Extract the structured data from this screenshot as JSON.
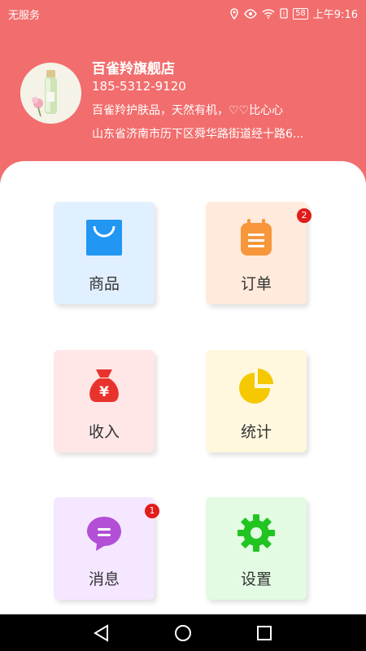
{
  "status_bar": {
    "carrier": "无服务",
    "battery": "58",
    "time": "上午9:16"
  },
  "profile": {
    "store_name": "百雀羚旗舰店",
    "phone": "185-5312-9120",
    "description": "百雀羚护肤品，天然有机，♡♡比心心",
    "address": "山东省济南市历下区舜华路街道经十路6..."
  },
  "menu": [
    {
      "label": "商品",
      "icon": "shopping-bag-icon",
      "bg": "#e1f0ff",
      "badge": ""
    },
    {
      "label": "订单",
      "icon": "order-clipboard-icon",
      "bg": "#ffeadb",
      "badge": "2"
    },
    {
      "label": "收入",
      "icon": "money-bag-icon",
      "bg": "#ffe7e7",
      "badge": ""
    },
    {
      "label": "统计",
      "icon": "pie-chart-icon",
      "bg": "#fff8df",
      "badge": ""
    },
    {
      "label": "消息",
      "icon": "message-bubble-icon",
      "bg": "#f5e7ff",
      "badge": "1"
    },
    {
      "label": "设置",
      "icon": "gear-icon",
      "bg": "#e2fbe2",
      "badge": ""
    }
  ],
  "nav": [
    "back-icon",
    "home-icon",
    "recent-apps-icon"
  ],
  "colors": {
    "header": "#f26d6d",
    "badge": "#e21b1b"
  }
}
